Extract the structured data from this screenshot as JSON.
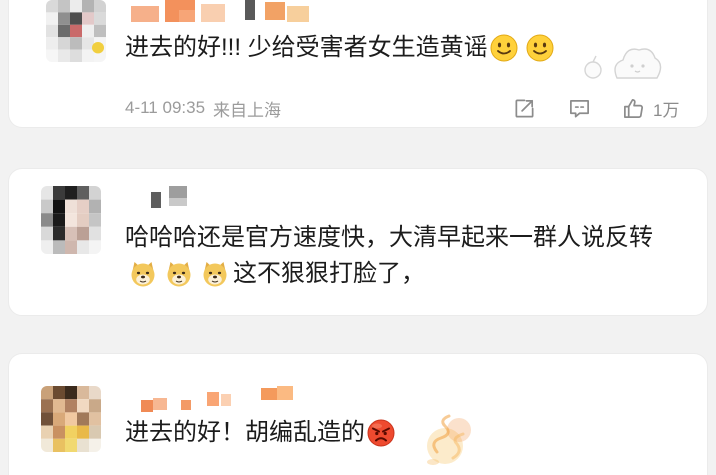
{
  "colors": {
    "page_background": "#f2f2f2",
    "card_background": "#ffffff",
    "text": "#1c1c1c",
    "meta_text": "#9b9b9b",
    "action_icon": "#8c8c8c"
  },
  "comments": [
    {
      "text": "进去的好!!! 少给受害者女生造黄谣",
      "emojis": [
        "smile-emoji",
        "smile-emoji"
      ],
      "sticker": "cloud-sticker-icon",
      "timestamp": "4-11 09:35",
      "source": "来自上海",
      "actions": {
        "share_icon": "share-icon",
        "comment_icon": "comment-icon",
        "like_icon": "thumbs-up-icon",
        "like_count": "1万"
      }
    },
    {
      "text_before_emojis": "哈哈哈还是官方速度快，大清早起来一群人说反转",
      "emojis": [
        "doge-emoji",
        "doge-emoji",
        "doge-emoji"
      ],
      "text_after_emojis": "这不狠狠打脸了，"
    },
    {
      "text": "进去的好！胡编乱造的",
      "emojis": [
        "angry-emoji"
      ],
      "sticker": "orange-sticker-icon"
    }
  ]
}
